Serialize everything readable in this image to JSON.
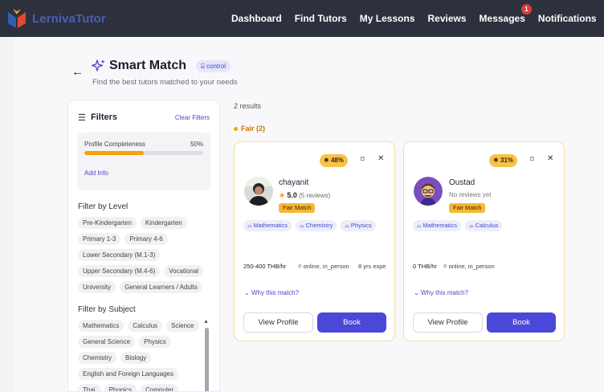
{
  "app": {
    "brand": "LernivaTutor"
  },
  "nav": {
    "items": [
      {
        "label": "Dashboard"
      },
      {
        "label": "Find Tutors"
      },
      {
        "label": "My Lessons"
      },
      {
        "label": "Reviews"
      },
      {
        "label": "Messages",
        "badge": "1"
      },
      {
        "label": "Notifications"
      }
    ]
  },
  "page": {
    "title": "Smart Match",
    "badge": "control",
    "subtitle": "Find the best tutors matched to your needs"
  },
  "filters": {
    "title": "Filters",
    "clear_label": "Clear Filters",
    "completeness": {
      "label": "Profile Completeness",
      "value": "50%",
      "fraction": 0.5,
      "add_info": "Add Info"
    },
    "level": {
      "title": "Filter by Level",
      "options": [
        "Pre-Kindergarten",
        "Kindergarten",
        "Primary 1-3",
        "Primary 4-6",
        "Lower Secondary (M.1-3)",
        "Upper Secondary (M.4-6)",
        "Vocational",
        "University",
        "General Learners / Adults"
      ]
    },
    "subject": {
      "title": "Filter by Subject",
      "options": [
        "Mathematics",
        "Calculus",
        "Science",
        "General Science",
        "Physics",
        "Chemistry",
        "Biology",
        "English and Foreign Languages",
        "Thai",
        "Phonics",
        "Computer"
      ]
    }
  },
  "results": {
    "count_text": "2 results",
    "group_label": "Fair (2)",
    "cards": [
      {
        "score": "48%",
        "name": "chayanit",
        "rating": "5.0",
        "reviews": "(5 reviews)",
        "match": "Fair Match",
        "subjects": [
          "Mathematics",
          "Chemistry",
          "Physics"
        ],
        "price": "250-400 THB/hr",
        "mode": "online, in_person",
        "experience": "8 yrs expe",
        "why": "Why this match?",
        "view_label": "View Profile",
        "book_label": "Book"
      },
      {
        "score": "31%",
        "name": "Oustad",
        "no_reviews": "No reviews yet",
        "match": "Fair Match",
        "subjects": [
          "Mathematics",
          "Calculus"
        ],
        "price": "0 THB/hr",
        "mode": "online, in_person",
        "why": "Why this match?",
        "view_label": "View Profile",
        "book_label": "Book"
      }
    ]
  },
  "colors": {
    "accent": "#4b47d9",
    "nav_bg": "#2d313d",
    "warning": "#f5a10b"
  }
}
